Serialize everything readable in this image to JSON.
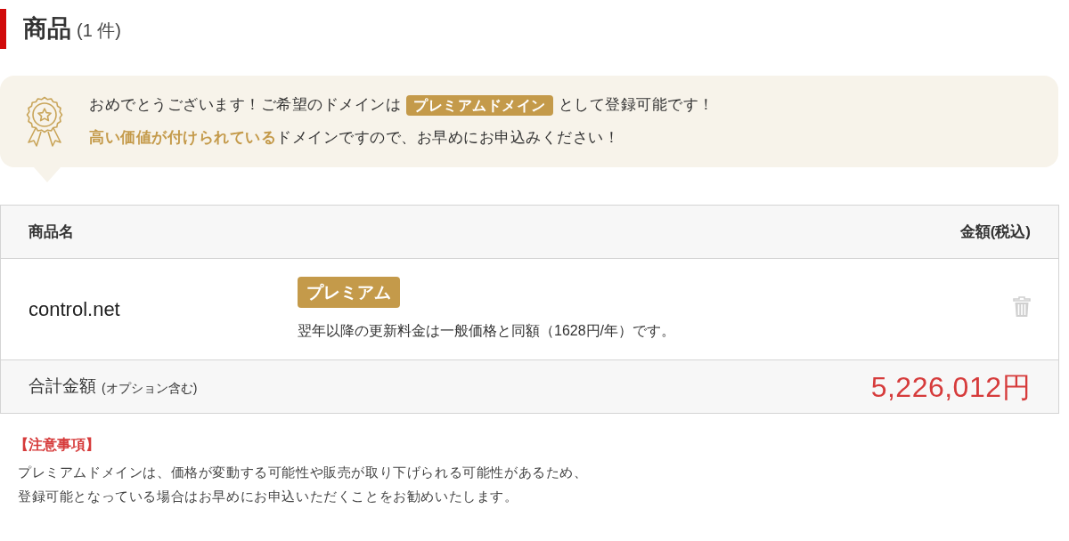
{
  "heading": {
    "title": "商品",
    "count": "(1 件)"
  },
  "notice": {
    "lines": [
      [
        {
          "kind": "text",
          "text": "おめでとうございます！ご希望のドメインは"
        },
        {
          "kind": "tag",
          "text": "プレミアムドメイン"
        },
        {
          "kind": "text",
          "text": "として登録可能です！"
        }
      ],
      [
        {
          "kind": "text",
          "text": "**高い価値が付けられている**ドメインですので、お早めにお申込みください！"
        }
      ]
    ]
  },
  "table": {
    "columns": [
      "商品名",
      "金額(税込)"
    ],
    "rows": [
      {
        "domain": "control.net",
        "tag": "プレミアム",
        "note": "翌年以降の更新料金は一般価格と同額（1628円/年）です。"
      }
    ],
    "total": {
      "label": "合計金額",
      "sublabel": "(オプション含む)",
      "amount": "5,226,012円"
    }
  },
  "notes": {
    "title": "【注意事項】",
    "lines": [
      "プレミアムドメインは、価格が変動する可能性や販売が取り下げられる可能性があるため、",
      "登録可能となっている場合はお早めにお申込いただくことをお勧めいたします。"
    ]
  }
}
